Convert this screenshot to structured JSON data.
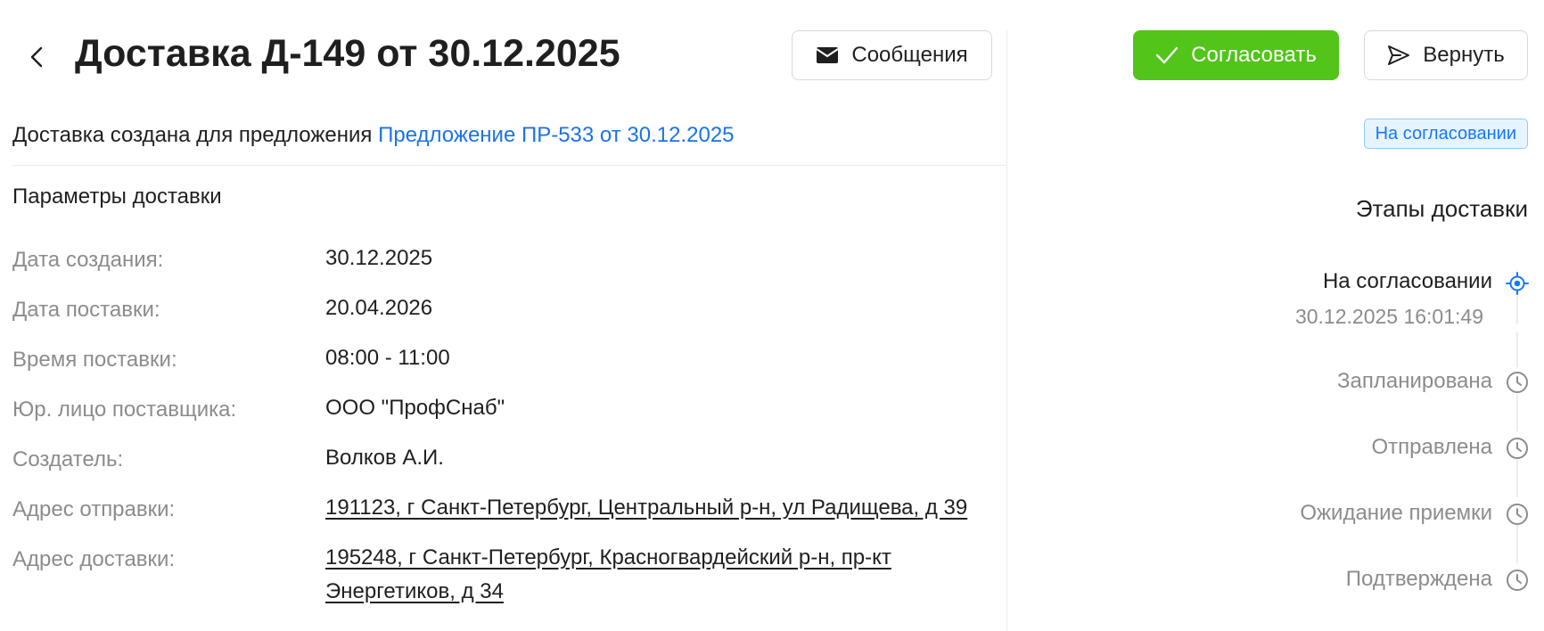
{
  "header": {
    "title": "Доставка Д-149 от 30.12.2025",
    "messages_label": "Сообщения"
  },
  "subtitle": {
    "prefix": "Доставка создана для предложения",
    "link": "Предложение ПР-533 от 30.12.2025"
  },
  "params": {
    "section_title": "Параметры доставки",
    "rows": [
      {
        "label": "Дата создания:",
        "value": "30.12.2025"
      },
      {
        "label": "Дата поставки:",
        "value": "20.04.2026"
      },
      {
        "label": "Время поставки:",
        "value": "08:00 - 11:00"
      },
      {
        "label": "Юр. лицо поставщика:",
        "value": "ООО \"ПрофСнаб\""
      },
      {
        "label": "Создатель:",
        "value": "Волков А.И."
      },
      {
        "label": "Адрес отправки:",
        "value": "191123, г Санкт-Петербург, Центральный р-н, ул Радищева, д 39"
      },
      {
        "label": "Адрес доставки:",
        "value": "195248, г Санкт-Петербург, Красногвардейский р-н, пр-кт Энергетиков, д 34"
      }
    ]
  },
  "actions": {
    "approve_label": "Согласовать",
    "return_label": "Вернуть"
  },
  "status": "На согласовании",
  "stages": {
    "title": "Этапы доставки",
    "items": [
      {
        "label": "На согласовании",
        "time": "30.12.2025 16:01:49",
        "state": "active"
      },
      {
        "label": "Запланирована",
        "state": "pending"
      },
      {
        "label": "Отправлена",
        "state": "pending"
      },
      {
        "label": "Ожидание приемки",
        "state": "pending"
      },
      {
        "label": "Подтверждена",
        "state": "pending"
      }
    ]
  },
  "colors": {
    "accent": "#52c41a",
    "link": "#1a73e8",
    "badge_bg": "#e6f4ff",
    "badge_text": "#1677ff"
  }
}
